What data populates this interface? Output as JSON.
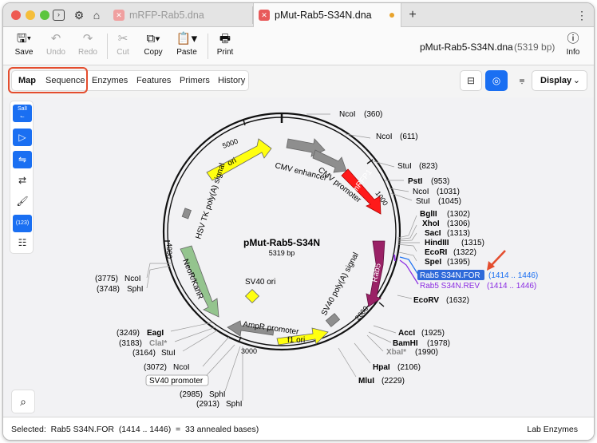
{
  "tabs": [
    {
      "label": "mRFP-Rab5.dna",
      "active": false
    },
    {
      "label": "pMut-Rab5-S34N.dna",
      "active": true
    }
  ],
  "toolbar": {
    "save": "Save",
    "undo": "Undo",
    "redo": "Redo",
    "cut": "Cut",
    "copy": "Copy",
    "paste": "Paste",
    "print": "Print",
    "info": "Info"
  },
  "document": {
    "name": "pMut-Rab5-S34N.dna",
    "size": "(5319 bp)"
  },
  "view_tabs": [
    "Map",
    "Sequence",
    "Enzymes",
    "Features",
    "Primers",
    "History"
  ],
  "display_label": "Display",
  "tools": {
    "sall": "SalI",
    "numbers": "(123)"
  },
  "map": {
    "name": "pMut-Rab5-S34N",
    "length": "5319 bp",
    "ticks": [
      "1000",
      "2000",
      "3000",
      "4000",
      "5000"
    ],
    "features": [
      "CMV enhancer",
      "CMV promoter",
      "mRFP1",
      "Rab5",
      "SV40 poly(A) signal",
      "f1 ori",
      "AmpR promoter",
      "NeoR/KanR",
      "HSV TK poly(A) signal",
      "ori",
      "SV40 ori"
    ],
    "sites_top": [
      {
        "name": "NcoI",
        "pos": "(360)"
      },
      {
        "name": "NcoI",
        "pos": "(611)"
      },
      {
        "name": "StuI",
        "pos": "(823)"
      },
      {
        "name": "PstI",
        "pos": "(953)"
      },
      {
        "name": "NcoI",
        "pos": "(1031)"
      },
      {
        "name": "StuI",
        "pos": "(1045)"
      }
    ],
    "sites_mcs": [
      {
        "name": "BglII",
        "pos": "(1302)"
      },
      {
        "name": "XhoI",
        "pos": "(1306)"
      },
      {
        "name": "SacI",
        "pos": "(1313)"
      },
      {
        "name": "HindIII",
        "pos": "(1315)"
      },
      {
        "name": "EcoRI",
        "pos": "(1322)"
      },
      {
        "name": "SpeI",
        "pos": "(1395)"
      }
    ],
    "primers": [
      {
        "name": "Rab5 S34N.FOR",
        "range": "(1414 .. 1446)"
      },
      {
        "name": "Rab5 S34N.REV",
        "range": "(1414 .. 1446)"
      }
    ],
    "sites_right": [
      {
        "name": "EcoRV",
        "pos": "(1632)"
      },
      {
        "name": "AccI",
        "pos": "(1925)"
      },
      {
        "name": "BamHI",
        "pos": "(1978)"
      },
      {
        "name": "XbaI*",
        "pos": "(1990)"
      },
      {
        "name": "HpaI",
        "pos": "(2106)"
      },
      {
        "name": "MluI",
        "pos": "(2229)"
      }
    ],
    "sites_left": [
      {
        "name": "NcoI",
        "pos": "(3775)"
      },
      {
        "name": "SphI",
        "pos": "(3748)"
      },
      {
        "name": "EagI",
        "pos": "(3249)"
      },
      {
        "name": "ClaI*",
        "pos": "(3183)"
      },
      {
        "name": "StuI",
        "pos": "(3164)"
      },
      {
        "name": "NcoI",
        "pos": "(3072)"
      },
      {
        "name": "SphI",
        "pos": "(2985)"
      },
      {
        "name": "SphI",
        "pos": "(2913)"
      }
    ],
    "sv40_promoter_label": "SV40 promoter"
  },
  "status": {
    "text": "Selected:  Rab5 S34N.FOR  (1414 .. 1446)  =  33 annealed bases)",
    "right": "Lab Enzymes"
  },
  "colors": {
    "accent": "#1a6ff2",
    "annotation": "#e44d2e",
    "rev_primer": "#8a2be2"
  }
}
